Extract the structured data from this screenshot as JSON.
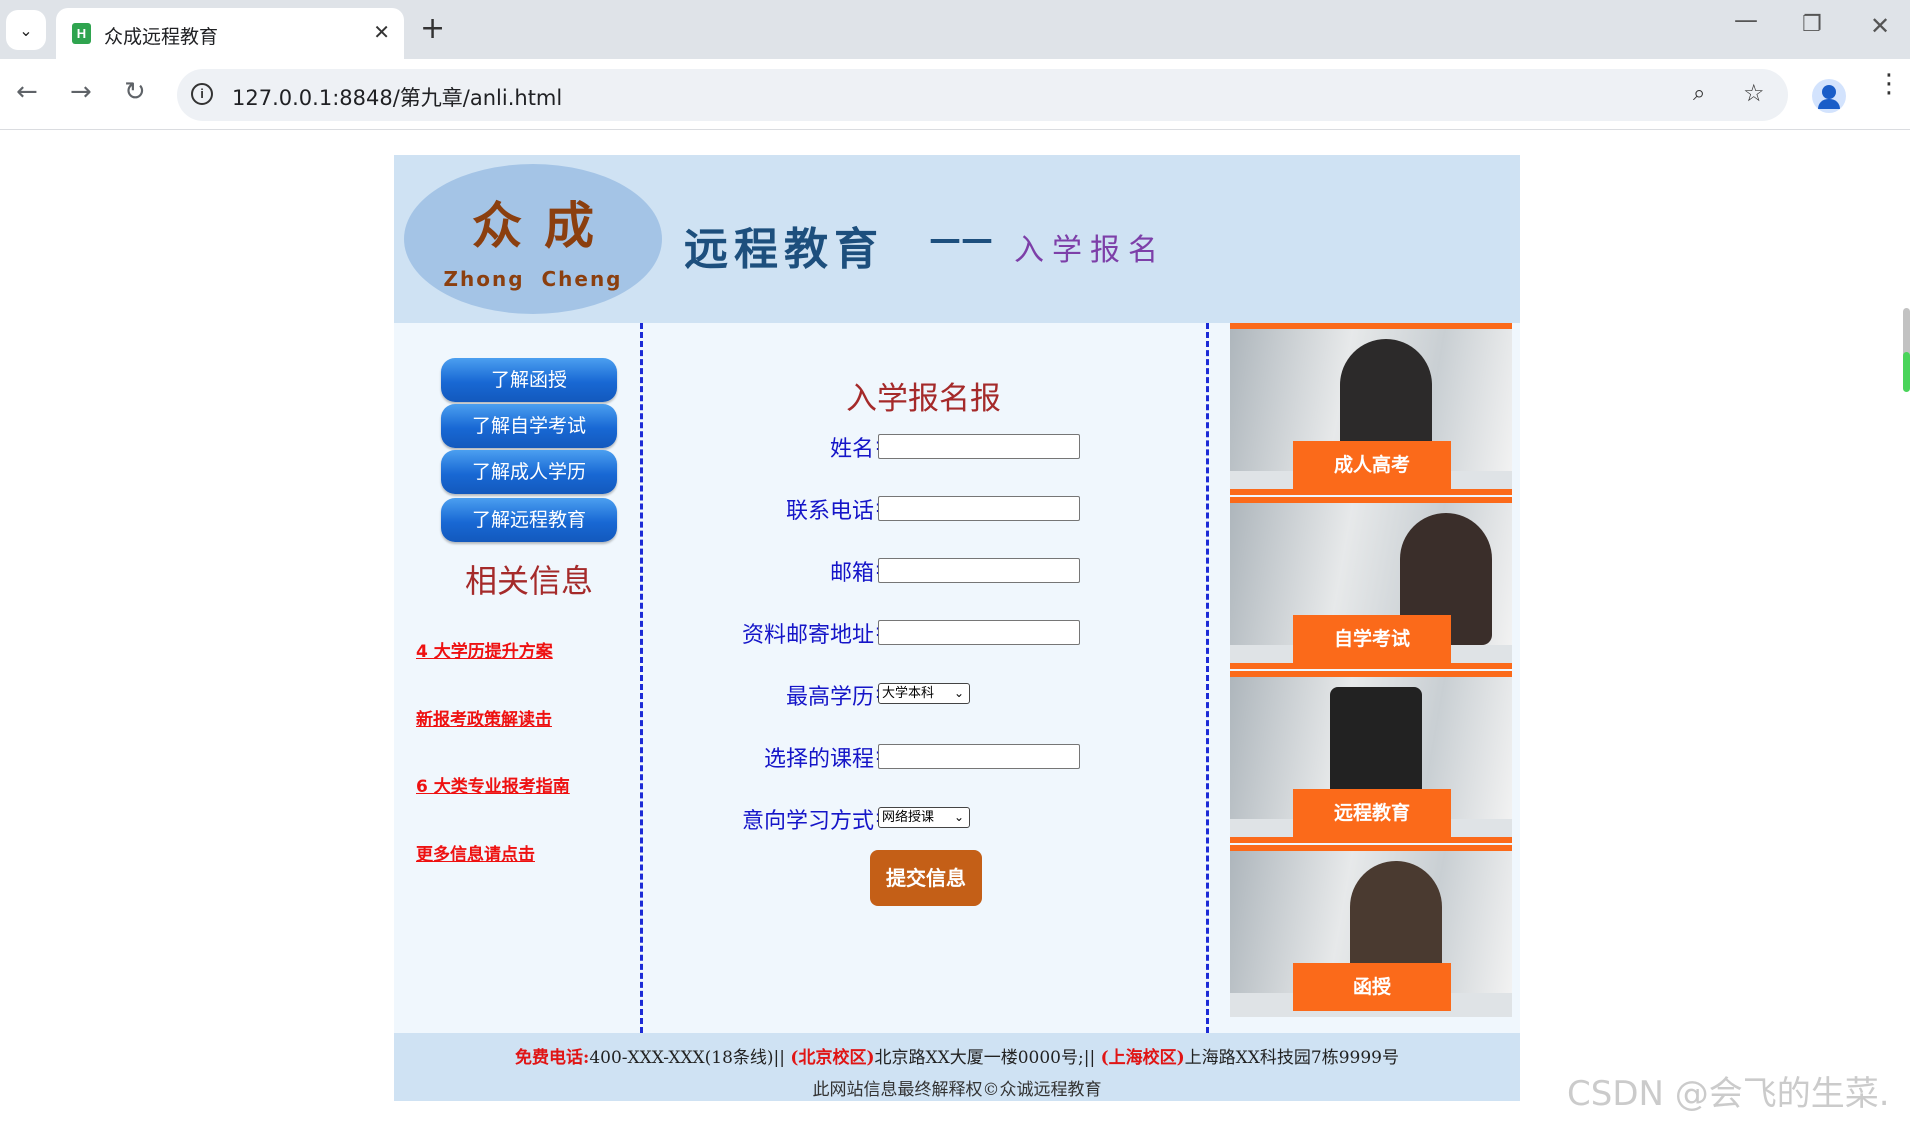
{
  "browser": {
    "tab_title": "众成远程教育",
    "url": "127.0.0.1:8848/第九章/anli.html"
  },
  "header": {
    "logo_cn": "众成",
    "logo_en": "Zhong Cheng",
    "title": "远程教育",
    "dash": "——",
    "subtitle": "入学报名"
  },
  "sidebar": {
    "nav": [
      "了解函授",
      "了解自学考试",
      "了解成人学历",
      "了解远程教育"
    ],
    "heading": "相关信息",
    "links": [
      "4 大学历提升方案",
      "新报考政策解读击",
      "6 大类专业报考指南",
      "更多信息请点击"
    ]
  },
  "form": {
    "title": "入学报名报",
    "fields": {
      "name": "姓名",
      "phone": "联系电话",
      "email": "邮箱",
      "address": "资料邮寄地址",
      "education": "最高学历",
      "course": "选择的课程",
      "mode": "意向学习方式"
    },
    "education_value": "大学本科",
    "mode_value": "网络授课",
    "submit": "提交信息"
  },
  "tiles": [
    "成人高考",
    "自学考试",
    "远程教育",
    "函授"
  ],
  "footer": {
    "phone_label": "免费电话:",
    "phone": "400-XXX-XXX(18条线)||",
    "beijing_label": "(北京校区)",
    "beijing": "北京路XX大厦一楼0000号;||",
    "shanghai_label": "(上海校区)",
    "shanghai": "上海路XX科技园7栋9999号",
    "copyright": "此网站信息最终解释权©众诚远程教育"
  },
  "watermark": "CSDN @会飞的生菜.",
  "icons": {
    "tab_menu": "chevron-down-icon",
    "favicon": "hbuilder-icon",
    "close": "close-icon",
    "new_tab": "plus-icon",
    "back": "arrow-left-icon",
    "forward": "arrow-right-icon",
    "reload": "reload-icon",
    "info": "info-icon",
    "zoom": "zoom-icon",
    "bookmark": "star-icon",
    "profile": "profile-icon",
    "menu": "kebab-menu-icon"
  },
  "colors": {
    "header_bg": "#cfe2f3",
    "page_bg": "#f0f7fd",
    "nav_button": "#1868d4",
    "label_blue": "#1515c8",
    "heading_red": "#a52a2a",
    "link_red": "#ee1111",
    "tile_orange": "#fb6a1a",
    "submit_brown": "#c45f17"
  }
}
